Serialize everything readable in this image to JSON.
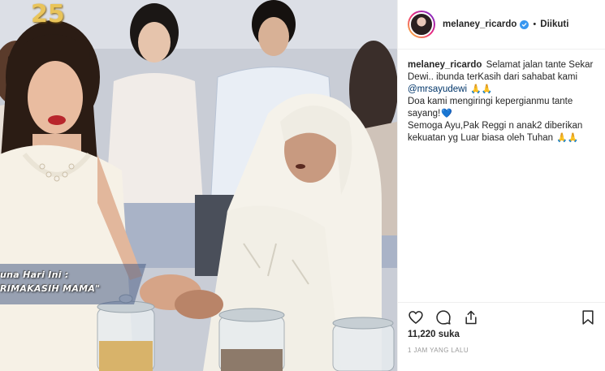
{
  "post": {
    "username": "melaney_ricardo",
    "dot": "•",
    "follow_label": "Diikuti",
    "caption": {
      "username": "melaney_ricardo",
      "line1": "Selamat jalan tante Sekar",
      "line2": "Dewi.. ibunda terKasih dari sahabat kami",
      "mention": "@mrsayudewi",
      "line3_emoji": "🙏🙏",
      "line4": "Doa kami mengiringi kepergianmu tante",
      "line5": "sayang!",
      "line5_emoji": "💙",
      "line6": "Semoga Ayu,Pak Reggi n anak2 diberikan",
      "line7": "kekuatan yg Luar biasa oleh Tuhan",
      "line7_emoji": "🙏🙏"
    },
    "likes": "11,220 suka",
    "timestamp": "1 JAM YANG LALU"
  },
  "media": {
    "overlay_line1": "una Hari Ini :",
    "overlay_line2": "RIMAKASIH MAMA\"",
    "logo_text": "25"
  },
  "icons": {
    "verified": "verified-badge-icon",
    "like": "heart-icon",
    "comment": "comment-icon",
    "share": "share-icon",
    "save": "bookmark-icon"
  },
  "colors": {
    "verified_blue": "#3897f0",
    "text": "#262626",
    "muted": "#999999",
    "mention": "#003569"
  }
}
